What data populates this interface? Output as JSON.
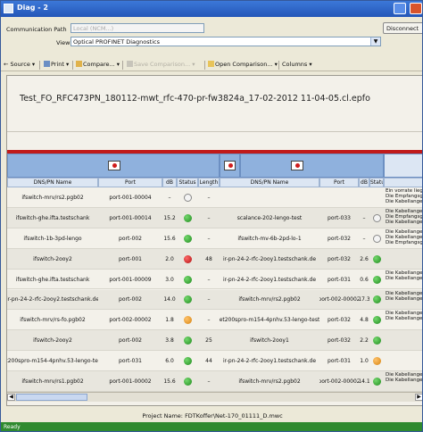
{
  "window": {
    "title": "Diag - 2"
  },
  "connection": {
    "path_label": "Communication Path",
    "path_value": "Local (NCM...)",
    "disconnect_label": "Disconnect",
    "view_label": "View",
    "view_value": "Optical PROFINET Diagnostics"
  },
  "toolbar": {
    "source": "Source",
    "print": "Print",
    "compare": "Compare...",
    "save_comparison": "Save Comparison...",
    "open_comparison": "Open Comparison...",
    "columns": "Columns"
  },
  "content": {
    "file_title": "Test_FO_RFC473PN_180112-mwt_rfc-470-pr-fw3824a_17-02-2012  11-04-05.cl.epfo"
  },
  "columns": [
    "DNS/PN Name",
    "Port",
    "dB",
    "Status",
    "Length",
    "DNS/PN Name",
    "Port",
    "dB",
    "Status"
  ],
  "rows": [
    {
      "name": "ifswitch-mrv/rs2.pgb02",
      "port": "port-001-00004",
      "db": "–",
      "status": "empty",
      "length": "–",
      "name2": "",
      "port2": "",
      "db2": "",
      "status2": "",
      "info": [
        "Ein vorrate liegt",
        "Die Empfangsge...",
        "Die Kabellange..."
      ]
    },
    {
      "name": "ifswitch-ghe.ifta.testschank",
      "port": "port-001-00014",
      "db": "15.2",
      "status": "green",
      "length": "–",
      "name2": "scalance-202-lengo-test",
      "port2": "port-033",
      "db2": "–",
      "status2": "empty",
      "info": [
        "Die Kabellange...",
        "Die Empfangsge...",
        "Die Kabellange..."
      ]
    },
    {
      "name": "ifswitch-1b-3pd-lengo",
      "port": "port-002",
      "db": "15.6",
      "status": "green",
      "length": "–",
      "name2": "ifswitch-mv-6b-2pd-lo-1",
      "port2": "port-032",
      "db2": "–",
      "status2": "empty",
      "info": [
        "Die Kabellange...",
        "Die Kabellange...",
        "Die Empfangsge..."
      ]
    },
    {
      "name": "ifswitch-2ooy2",
      "port": "port-001",
      "db": "2.0",
      "status": "red",
      "length": "48",
      "name2": "ir-pn-24-2-rfc-2ooy1.testschank.de",
      "port2": "port-032",
      "db2": "2.6",
      "status2": "green",
      "info": []
    },
    {
      "name": "ifswitch-ghe.ifta.testschank",
      "port": "port-001-00009",
      "db": "3.0",
      "status": "green",
      "length": "–",
      "name2": "ir-pn-24-2-rfc-2ooy1.testschank.de",
      "port2": "port-031",
      "db2": "0.6",
      "status2": "green",
      "info": [
        "Die Kabellange...",
        "Die Kabellange..."
      ]
    },
    {
      "name": "ir-pn-24-2-rfc-2ooy2.testschank.de",
      "port": "port-002",
      "db": "14.0",
      "status": "green",
      "length": "–",
      "name2": "ifswitch-mrv/rs2.pgb02",
      "port2": "port-002-00002",
      "db2": "17.3",
      "status2": "green",
      "info": [
        "Die Kabellange...",
        "Die Kabellange..."
      ]
    },
    {
      "name": "ifswitch-mrv/rs-fo.pgb02",
      "port": "port-002-00002",
      "db": "1.8",
      "status": "orange",
      "length": "–",
      "name2": "et200spro-m154-4pnhv.53-lengo-test",
      "port2": "port-032",
      "db2": "4.8",
      "status2": "green",
      "info": [
        "Die Kabellange...",
        "Die Kabellange..."
      ]
    },
    {
      "name": "ifswitch-2ooy2",
      "port": "port-002",
      "db": "3.8",
      "status": "green",
      "length": "25",
      "name2": "ifswitch-2ooy1",
      "port2": "port-032",
      "db2": "2.2",
      "status2": "green",
      "info": []
    },
    {
      "name": "et200spro-m154-4pnhv.53-lengo-test",
      "port": "port-031",
      "db": "6.0",
      "status": "green",
      "length": "44",
      "name2": "ir-pn-24-2-rfc-2ooy1.testschank.de",
      "port2": "port-031",
      "db2": "1.0",
      "status2": "orange",
      "info": []
    },
    {
      "name": "ifswitch-mrv/rs1.pgb02",
      "port": "port-001-00002",
      "db": "15.6",
      "status": "green",
      "length": "–",
      "name2": "ifswitch-mrv/rs2.pgb02",
      "port2": "port-002-00002",
      "db2": "14.1",
      "status2": "green",
      "info": [
        "Die Kabellange...",
        "Die Kabellange..."
      ]
    }
  ],
  "project": {
    "text": "Project Name: FDTKoffer\\Net-170_01111_D.mwc"
  },
  "status_bar": {
    "text": "Ready"
  }
}
